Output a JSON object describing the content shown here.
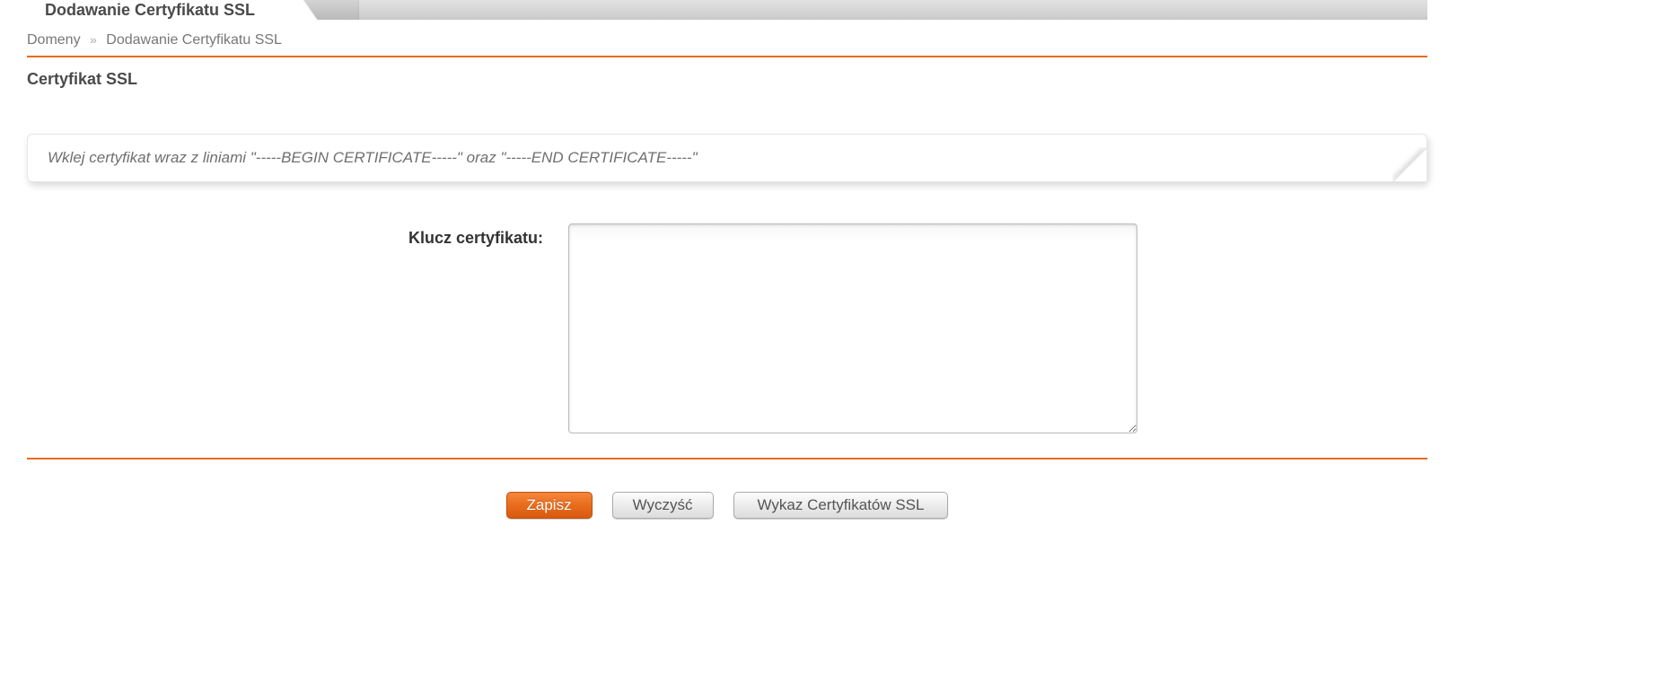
{
  "colors": {
    "accent": "#e66b1f"
  },
  "header": {
    "tab_title": "Dodawanie Certyfikatu SSL"
  },
  "breadcrumb": {
    "items": [
      {
        "label": "Domeny"
      },
      {
        "label": "Dodawanie Certyfikatu SSL"
      }
    ],
    "separator": "»"
  },
  "section": {
    "title": "Certyfikat SSL",
    "info_text": "Wklej certyfikat wraz z liniami \"-----BEGIN CERTIFICATE-----\" oraz \"-----END CERTIFICATE-----\""
  },
  "form": {
    "key_label": "Klucz certyfikatu:",
    "key_value": ""
  },
  "buttons": {
    "save": "Zapisz",
    "clear": "Wyczyść",
    "list": "Wykaz Certyfikatów SSL"
  }
}
